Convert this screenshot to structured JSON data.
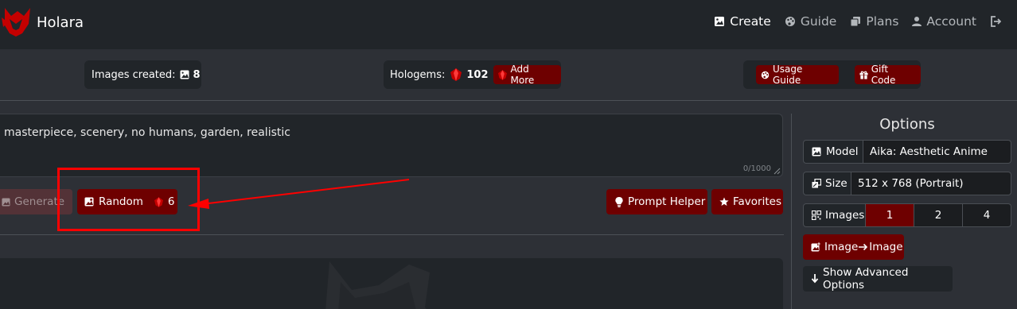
{
  "brand": {
    "name": "Holara"
  },
  "nav": [
    {
      "label": "Create",
      "icon": "image-icon"
    },
    {
      "label": "Guide",
      "icon": "palette-icon"
    },
    {
      "label": "Plans",
      "icon": "stack-icon"
    },
    {
      "label": "Account",
      "icon": "user-icon"
    }
  ],
  "stats": {
    "images_label": "Images created:",
    "images_count": "8",
    "hologems_label": "Hologems:",
    "hologems_count": "102",
    "add_more_label": "Add More",
    "usage_guide_label": "Usage Guide",
    "gift_code_label": "Gift Code"
  },
  "prompt": {
    "text": "masterpiece, scenery, no humans, garden, realistic",
    "char_count": "0/1000"
  },
  "actions": {
    "generate_label": "Generate",
    "random_label": "Random",
    "random_cost": "6",
    "prompt_helper_label": "Prompt Helper",
    "favorites_label": "Favorites"
  },
  "options": {
    "title": "Options",
    "model_label": "Model",
    "model_value": "Aika: Aesthetic Anime",
    "size_label": "Size",
    "size_value": "512 x 768 (Portrait)",
    "images_label": "Images",
    "images_choices": [
      "1",
      "2",
      "4"
    ],
    "images_selected": "1",
    "img2img_label_a": "Image",
    "img2img_label_b": "Image",
    "advanced_label": "Show Advanced Options"
  },
  "colors": {
    "accent": "#6e0000",
    "background": "#2d3036",
    "panel": "#212529",
    "annotation": "#ff0000"
  }
}
